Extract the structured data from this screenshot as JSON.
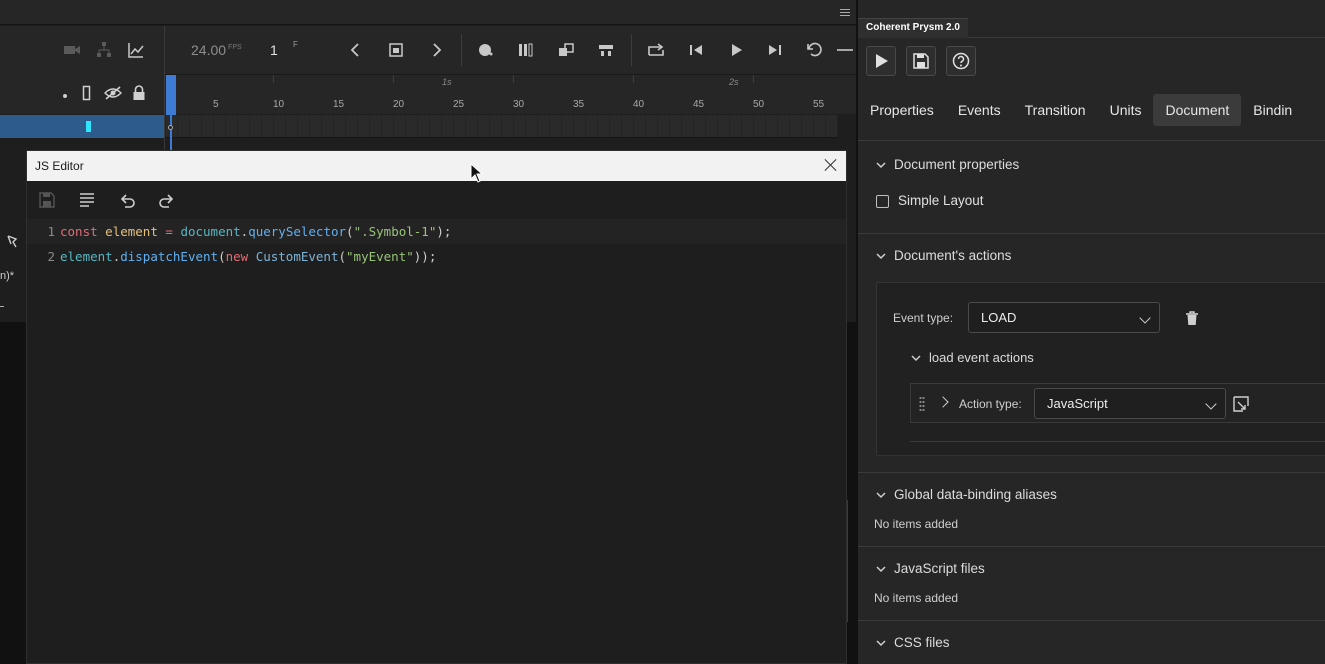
{
  "timeline": {
    "fps_value": "24.00",
    "fps_unit": "FPS",
    "frame": "1",
    "frame_unit": "F",
    "ruler_numbers": [
      "5",
      "10",
      "15",
      "20",
      "25",
      "30",
      "35",
      "40",
      "45",
      "50",
      "55"
    ],
    "ruler_seconds": [
      "1s",
      "2s"
    ]
  },
  "side": {
    "doc_label": "n)*"
  },
  "js_editor": {
    "title": "JS Editor",
    "line_numbers": [
      "1",
      "2"
    ],
    "code": {
      "line1": {
        "kw": "const",
        "var": "element",
        "op": "=",
        "obj": "document",
        "fn": "querySelector",
        "str": "\".Symbol-1\"",
        "end": ");"
      },
      "line2": {
        "obj": "element",
        "fn": "dispatchEvent",
        "kw": "new",
        "cls": "CustomEvent",
        "str": "\"myEvent\"",
        "end": "));"
      }
    }
  },
  "panel": {
    "title": "Coherent Prysm 2.0",
    "tabs": [
      "Properties",
      "Events",
      "Transition",
      "Units",
      "Document",
      "Bindin"
    ],
    "active_tab": "Document",
    "document_properties": {
      "heading": "Document properties",
      "simple_layout_label": "Simple Layout",
      "simple_layout_checked": false
    },
    "documents_actions": {
      "heading": "Document's actions",
      "event_type_label": "Event type:",
      "event_type_value": "LOAD",
      "sub_heading": "load event actions",
      "action_type_label": "Action type:",
      "action_type_value": "JavaScript"
    },
    "global_aliases": {
      "heading": "Global data-binding aliases",
      "empty": "No items added"
    },
    "js_files": {
      "heading": "JavaScript files",
      "empty": "No items added"
    },
    "css_files": {
      "heading": "CSS files"
    }
  },
  "colors": {
    "accent_blue": "#3d7bd4",
    "layer_row": "#2c5b8c",
    "layer_marker": "#2ee6ff"
  }
}
